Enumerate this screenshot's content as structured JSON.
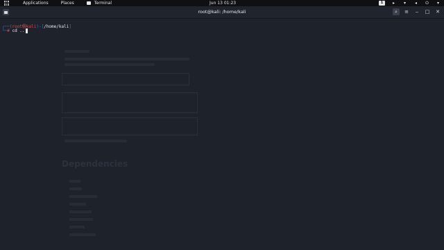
{
  "panel": {
    "menus": [
      "Applications",
      "Places",
      "Terminal"
    ],
    "clock": "Jun 13  01:23",
    "workspace": "1",
    "tray_icons": [
      "screencast-icon",
      "network-icon",
      "volume-icon",
      "power-icon",
      "menu-chevron-icon"
    ]
  },
  "window": {
    "title": "root@kali: /home/kali"
  },
  "terminal": {
    "prompt_open": "┌──(",
    "user": "root㉿kali",
    "prompt_mid": ")-[",
    "path": "/home/kali",
    "prompt_close": "]",
    "prompt2_prefix": "└─",
    "sigil": "#",
    "command": " cd .."
  },
  "background_page": {
    "heading": "Dependencies"
  }
}
